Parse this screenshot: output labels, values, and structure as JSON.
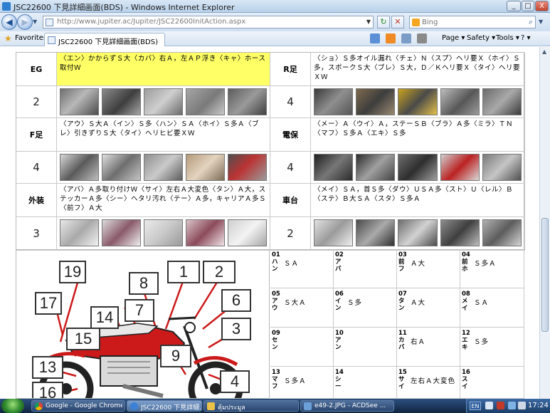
{
  "window": {
    "title": "JSC22600 下見詳細画面(BDS) - Windows Internet Explorer",
    "btn_minimize": "_",
    "btn_maximize": "□",
    "btn_close": "X"
  },
  "address_bar": {
    "back_label": "◀",
    "forward_label": "▶",
    "url": "http://www.jupiter.ac/Jupiter/JSC22600InitAction.aspx",
    "refresh_label": "↻",
    "stop_label": "✕",
    "search_placeholder": "Bing",
    "search_icon_label": "⌕"
  },
  "command_bar": {
    "favorites_label": "Favorites",
    "tab_title": "JSC22600 下見詳細画面(BDS)",
    "page_label": "Page ▾",
    "safety_label": "Safety ▾",
    "tools_label": "Tools ▾",
    "help_label": "? ▾"
  },
  "inspection": {
    "rows": [
      {
        "left_label": "EG",
        "left_comment": "〈エン〉かからずＳ大〈カバ〉右Ａ，左ＡＰ浮き〈キャ〉ホース取付Ｗ",
        "right_label": "R足",
        "right_comment": "〈ショ〉Ｓ多オイル漏れ〈チェ〉Ｎ〈スプ〉ヘリ要Ｘ〈ホイ〉Ｓ多，スポークＳ大〈ブレ〉Ｓ大，Ｄ／Ｋヘリ要Ｘ〈タイ〉ヘリ要ＸＷ",
        "left_score": "2",
        "right_score": "4"
      },
      {
        "left_label": "F足",
        "left_comment": "〈アウ〉Ｓ大Ａ〈イン〉Ｓ多〈ハン〉ＳＡ〈ホイ〉Ｓ多Ａ〈ブレ〉引きずりＳ大〈タイ〉ヘリヒビ要ＸＷ",
        "right_label": "電保",
        "right_comment": "〈メー〉Ａ〈ウイ〉Ａ，ステーＳＢ〈ブラ〉Ａ多〈ミラ〉ＴＮ〈マフ〉Ｓ多Ａ〈エキ〉Ｓ多",
        "left_score": "4",
        "right_score": "4"
      },
      {
        "left_label": "外装",
        "left_comment": "〈アバ〉Ａ多取り付けＷ〈サイ〉左右Ａ大変色〈タン〉Ａ大，ステッカーＡ多〈シー〉ヘタリ汚れ〈テー〉Ａ多，キャリアＡ多Ｓ〈前フ〉Ａ大",
        "right_label": "車台",
        "right_comment": "〈メイ〉ＳＡ，首Ｓ多〈ダウ〉ＵＳＡ多〈スト〉Ｕ〈レル〉Ｂ〈ステ〉Ｂ大ＳＡ〈スタ〉Ｓ多Ａ",
        "left_score": "3",
        "right_score": "2"
      }
    ]
  },
  "diagram": {
    "callouts": [
      "19",
      "1",
      "2",
      "8",
      "6",
      "17",
      "7",
      "14",
      "3",
      "15",
      "9",
      "13",
      "4",
      "16"
    ]
  },
  "codes": [
    {
      "key": "01ハン",
      "value": "ＳＡ"
    },
    {
      "key": "02アバ",
      "value": ""
    },
    {
      "key": "03前フ",
      "value": "Ａ大"
    },
    {
      "key": "04前ホ",
      "value": "Ｓ多Ａ"
    },
    {
      "key": "05アウ",
      "value": "Ｓ大Ａ"
    },
    {
      "key": "06イン",
      "value": "Ｓ多"
    },
    {
      "key": "07タン",
      "value": "Ａ大"
    },
    {
      "key": "08メイ",
      "value": "ＳＡ"
    },
    {
      "key": "09セン",
      "value": ""
    },
    {
      "key": "10アン",
      "value": ""
    },
    {
      "key": "11カバ",
      "value": "右Ａ"
    },
    {
      "key": "12エキ",
      "value": "Ｓ多"
    },
    {
      "key": "13マフ",
      "value": "Ｓ多Ａ"
    },
    {
      "key": "14シー",
      "value": ""
    },
    {
      "key": "15サイ",
      "value": "左右Ａ大変色"
    },
    {
      "key": "16スイ",
      "value": ""
    }
  ],
  "taskbar": {
    "items": [
      {
        "label": "Google - Google Chrome"
      },
      {
        "label": "JSC22600 下見詳細..."
      },
      {
        "label": "คุ้มประมูล"
      },
      {
        "label": "e49-2.JPG - ACDSee ..."
      }
    ],
    "language": "EN",
    "clock": "17:24"
  },
  "colors": {
    "highlight": "#ffff66",
    "titlebar": "#c9dcf0",
    "taskbar": "#1e3a60",
    "bike_red": "#cc1a1a"
  }
}
